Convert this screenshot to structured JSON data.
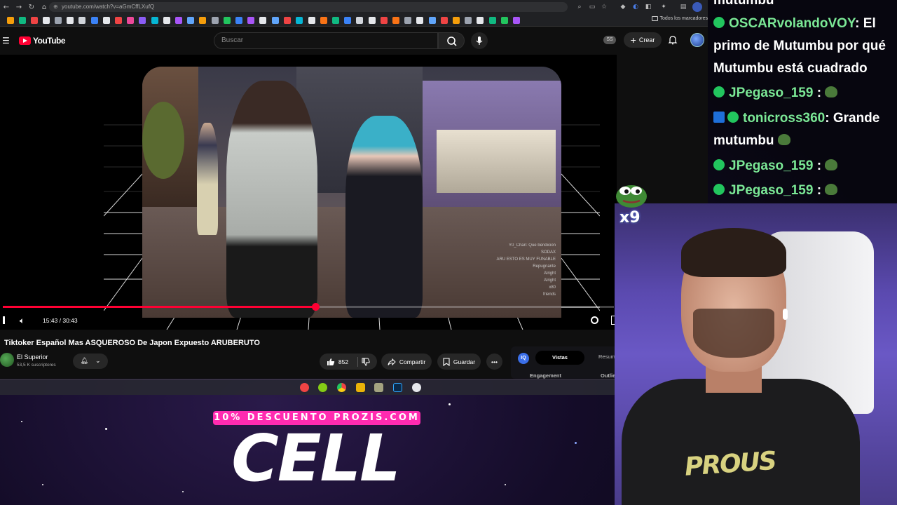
{
  "browser": {
    "url": "youtube.com/watch?v=aGmCffLXufQ",
    "bookmarks_folder": "Todos los marcadores"
  },
  "youtube": {
    "logo_text": "YouTube",
    "search_placeholder": "Buscar",
    "ss_badge": "SS",
    "create_label": "Crear",
    "menu_icon": "hamburger-icon",
    "search_icon": "search-icon",
    "mic_icon": "mic-icon",
    "bell_icon": "bell-icon"
  },
  "player": {
    "current_time": "15:43",
    "duration": "30:43",
    "time_display": "15:43 / 30:43",
    "progress": 0.512,
    "overlay_chat": [
      "Y0_Chan: Que bendicion",
      "SODAX",
      "ARU ESTO ES MUY FUNABLE",
      "Repugnante",
      "Alright",
      "Alright",
      "x80",
      "friends"
    ]
  },
  "video": {
    "title": "Tiktoker Español Mas ASQUEROSO De Japon Expuesto ARUBERUTO",
    "channel": "El Superior",
    "subscribers": "53,5 K suscriptores",
    "likes": "852",
    "share_label": "Compartir",
    "save_label": "Guardar"
  },
  "side_panel": {
    "tab_active": "Vistas",
    "tab_other": "Resum",
    "label_left": "Engagement",
    "label_right": "Outlie"
  },
  "chat": {
    "messages": [
      {
        "user": "mutumbu",
        "text": ""
      },
      {
        "user": "OSCARvolandoVOY",
        "text": ": El primo de Mutumbu por qué Mutumbu está cuadrado"
      },
      {
        "user": "JPegaso_159",
        "text": " :"
      },
      {
        "user": "tonicross360",
        "text": ": Grande mutumbu"
      },
      {
        "user": "JPegaso_159",
        "text": " :"
      },
      {
        "user": "JPegaso_159",
        "text": " :"
      }
    ],
    "emote_count": "x9"
  },
  "promo": {
    "discount": "10% DESCUENTO PROZIS.COM",
    "headline": "CELL"
  },
  "colors": {
    "youtube_red": "#ff0033",
    "chat_username": "#7be896",
    "promo_pink": "#ff2bb0",
    "webcam_bg": "#5b4ab0"
  }
}
